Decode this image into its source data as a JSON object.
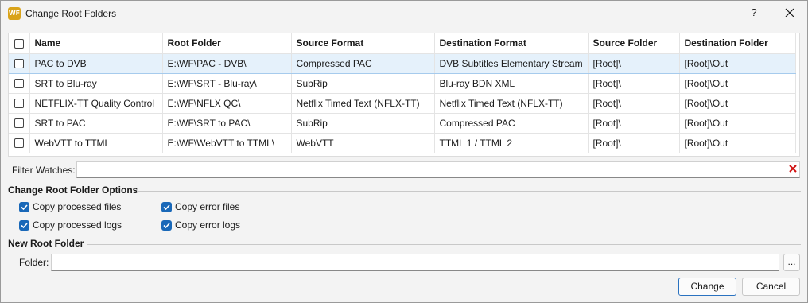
{
  "window": {
    "title": "Change Root Folders",
    "app_icon_text": "WF",
    "help_label": "?",
    "accent_color": "#1968b8"
  },
  "table": {
    "columns": [
      "Name",
      "Root Folder",
      "Source Format",
      "Destination Format",
      "Source Folder",
      "Destination Folder"
    ],
    "rows": [
      {
        "name": "PAC to DVB",
        "root": "E:\\WF\\PAC - DVB\\",
        "src_fmt": "Compressed PAC",
        "dst_fmt": "DVB Subtitles Elementary Stream",
        "src_folder": "[Root]\\",
        "dst_folder": "[Root]\\Out",
        "selected": true
      },
      {
        "name": "SRT to Blu-ray",
        "root": "E:\\WF\\SRT - Blu-ray\\",
        "src_fmt": "SubRip",
        "dst_fmt": "Blu-ray BDN XML",
        "src_folder": "[Root]\\",
        "dst_folder": "[Root]\\Out",
        "selected": false
      },
      {
        "name": "NETFLIX-TT Quality Control",
        "root": "E:\\WF\\NFLX QC\\",
        "src_fmt": "Netflix Timed Text (NFLX-TT)",
        "dst_fmt": "Netflix Timed Text (NFLX-TT)",
        "src_folder": "[Root]\\",
        "dst_folder": "[Root]\\Out",
        "selected": false
      },
      {
        "name": "SRT to PAC",
        "root": "E:\\WF\\SRT to PAC\\",
        "src_fmt": "SubRip",
        "dst_fmt": "Compressed PAC",
        "src_folder": "[Root]\\",
        "dst_folder": "[Root]\\Out",
        "selected": false
      },
      {
        "name": "WebVTT to TTML",
        "root": "E:\\WF\\WebVTT to TTML\\",
        "src_fmt": "WebVTT",
        "dst_fmt": "TTML 1 / TTML 2",
        "src_folder": "[Root]\\",
        "dst_folder": "[Root]\\Out",
        "selected": false
      }
    ]
  },
  "filter": {
    "label": "Filter Watches:",
    "value": "",
    "clear_icon": "red-x-icon"
  },
  "options": {
    "header": "Change Root Folder Options",
    "copy_processed_files": "Copy processed files",
    "copy_processed_logs": "Copy processed logs",
    "copy_error_files": "Copy error files",
    "copy_error_logs": "Copy error logs"
  },
  "new_root": {
    "header": "New Root Folder",
    "folder_label": "Folder:",
    "folder_value": "",
    "browse_label": "..."
  },
  "buttons": {
    "change": "Change",
    "cancel": "Cancel"
  }
}
